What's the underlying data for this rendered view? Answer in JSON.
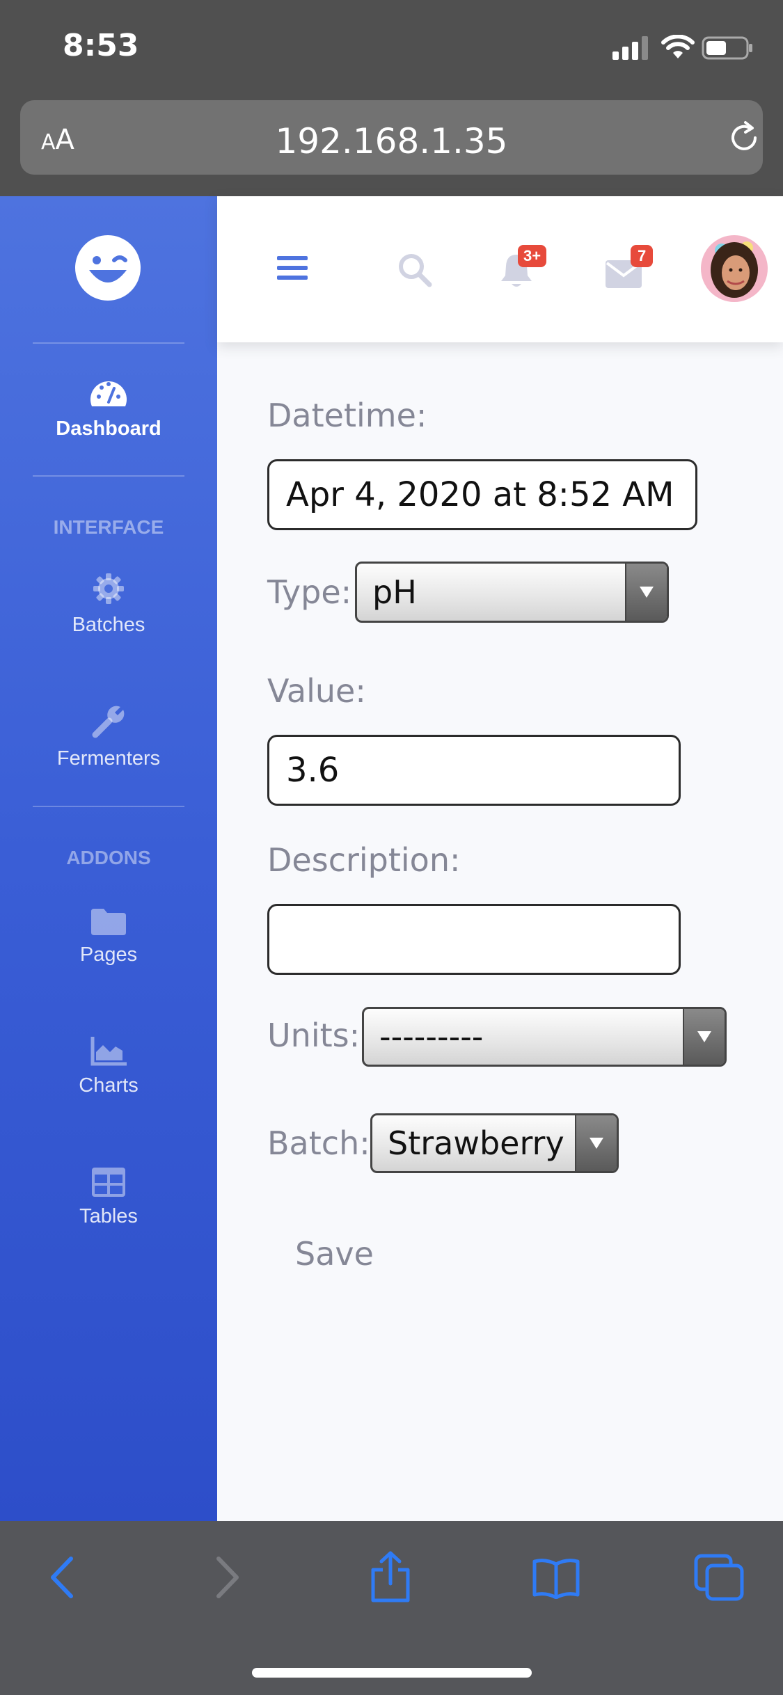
{
  "status_bar": {
    "time": "8:53"
  },
  "browser": {
    "text_size_label_small": "A",
    "text_size_label_large": "A",
    "url": "192.168.1.35"
  },
  "sidebar": {
    "items": [
      {
        "label": "Dashboard",
        "icon": "tachometer-icon",
        "active": true
      },
      {
        "heading": "INTERFACE"
      },
      {
        "label": "Batches",
        "icon": "gear-icon"
      },
      {
        "label": "Fermenters",
        "icon": "wrench-icon"
      },
      {
        "heading": "ADDONS"
      },
      {
        "label": "Pages",
        "icon": "folder-icon"
      },
      {
        "label": "Charts",
        "icon": "area-chart-icon"
      },
      {
        "label": "Tables",
        "icon": "table-icon"
      }
    ]
  },
  "topbar": {
    "alerts_badge": "3+",
    "messages_badge": "7"
  },
  "form": {
    "datetime_label": "Datetime:",
    "datetime_value": "Apr 4, 2020 at 8:52 AM",
    "type_label": "Type:",
    "type_value": "pH",
    "value_label": "Value:",
    "value_value": "3.6",
    "description_label": "Description:",
    "description_value": "",
    "units_label": "Units:",
    "units_value": "---------",
    "batch_label": "Batch:",
    "batch_value": "Strawberry",
    "save_label": "Save"
  },
  "colors": {
    "sidebar_primary": "#4e73df",
    "badge_red": "#e74a3b",
    "label_gray": "#858796",
    "ios_blue": "#2f7bf5"
  }
}
